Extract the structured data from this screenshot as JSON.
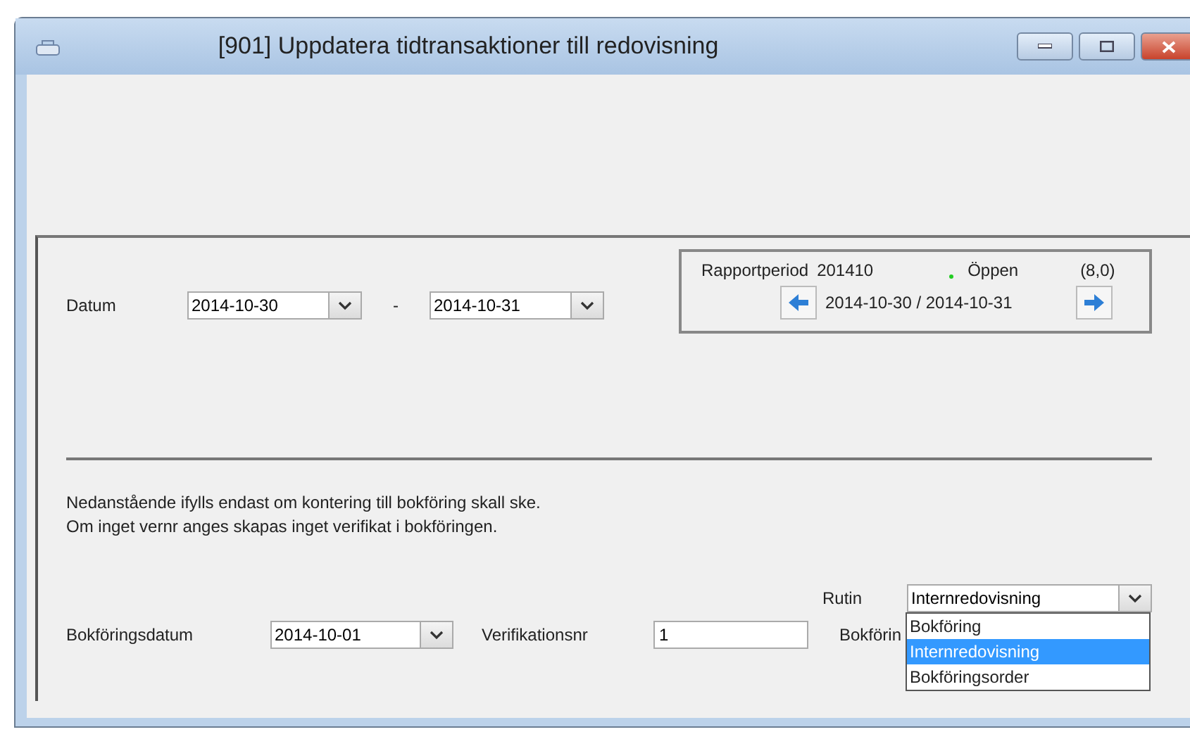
{
  "window": {
    "title": "[901]  Uppdatera tidtransaktioner till redovisning"
  },
  "datum": {
    "label": "Datum",
    "from": "2014-10-30",
    "separator": "-",
    "to": "2014-10-31"
  },
  "period": {
    "label": "Rapportperiod",
    "value": "201410",
    "status": "Öppen",
    "count": "(8,0)",
    "range": "2014-10-30 / 2014-10-31"
  },
  "info": [
    "Nedanstående ifylls endast om kontering till bokföring skall ske.",
    "Om inget vernr anges skapas inget verifikat i bokföringen."
  ],
  "rutin": {
    "label": "Rutin",
    "value": "Internredovisning",
    "expanded": true,
    "options": [
      {
        "label": "Bokföring",
        "selected": false
      },
      {
        "label": "Internredovisning",
        "selected": true
      },
      {
        "label": "Bokföringsorder",
        "selected": false
      }
    ]
  },
  "bokforingsdatum": {
    "label": "Bokföringsdatum",
    "value": "2014-10-01"
  },
  "verifikationsnr": {
    "label": "Verifikationsnr",
    "value": "1"
  },
  "column_3_label": "Bokförin"
}
